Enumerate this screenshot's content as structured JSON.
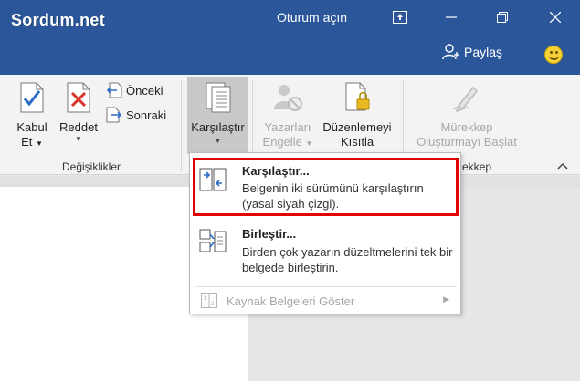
{
  "titlebar": {
    "logo": "Sordum.net",
    "signin": "Oturum açın",
    "share": "Paylaş"
  },
  "ribbon": {
    "accept": {
      "line1": "Kabul",
      "line2": "Et"
    },
    "reject": {
      "label": "Reddet"
    },
    "previous": "Önceki",
    "next": "Sonraki",
    "group_changes": "Değişiklikler",
    "compare": "Karşılaştır",
    "block_authors": {
      "line1": "Yazarları",
      "line2": "Engelle"
    },
    "restrict_editing": {
      "line1": "Düzenlemeyi",
      "line2": "Kısıtla"
    },
    "start_inking": {
      "line1": "Mürekkep",
      "line2": "Oluşturmayı Başlat"
    },
    "group_ink_partial": "ekkep"
  },
  "menu": {
    "compare": {
      "title": "Karşılaştır...",
      "desc": "Belgenin iki sürümünü karşılaştırın (yasal siyah çizgi)."
    },
    "combine": {
      "title": "Birleştir...",
      "desc": "Birden çok yazarın düzeltmelerini tek bir belgede birleştirin."
    },
    "show_source": "Kaynak Belgeleri Göster"
  },
  "colors": {
    "titlebar": "#2b579a",
    "highlight": "#e00000",
    "ribbon": "#f3f3f3"
  }
}
